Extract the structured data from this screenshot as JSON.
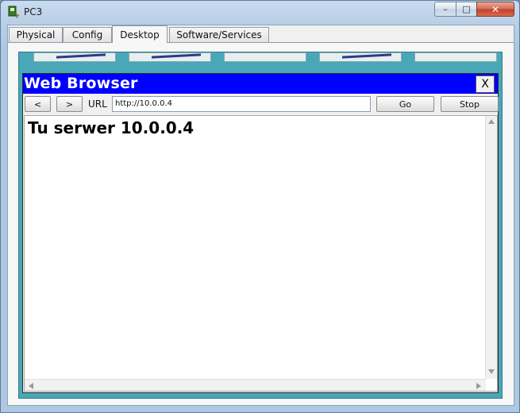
{
  "window": {
    "title": "PC3",
    "controls": {
      "minimize": "–",
      "maximize": "□",
      "close": "✕"
    }
  },
  "tabs": [
    {
      "label": "Physical"
    },
    {
      "label": "Config"
    },
    {
      "label": "Desktop"
    },
    {
      "label": "Software/Services"
    }
  ],
  "browser": {
    "title": "Web Browser",
    "close_label": "X",
    "back_label": "<",
    "forward_label": ">",
    "url_label": "URL",
    "url_value": "http://10.0.0.4",
    "go_label": "Go",
    "stop_label": "Stop",
    "page_heading": "Tu serwer 10.0.0.4"
  },
  "colors": {
    "browser_title_bar": "#0000ff",
    "desktop_background": "#4aa7b8"
  }
}
